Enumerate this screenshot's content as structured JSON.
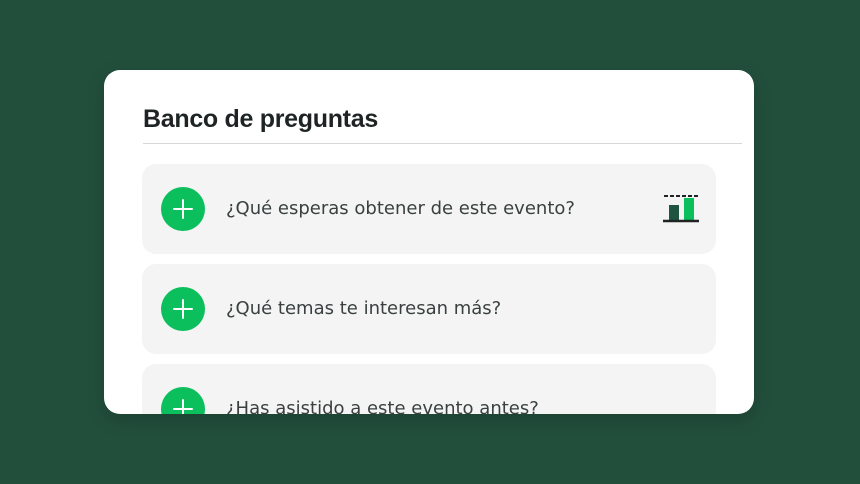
{
  "question_bank": {
    "title": "Banco de preguntas",
    "questions": [
      {
        "text": "¿Qué esperas obtener de este evento?",
        "icon": "bar-chart-icon"
      },
      {
        "text": "¿Qué temas te interesan más?"
      },
      {
        "text": "¿Has asistido a este evento antes?"
      }
    ]
  },
  "icons": {
    "add": "plus-icon",
    "type": "bar-chart-icon"
  },
  "colors": {
    "background": "#224f3c",
    "accent": "#0bbf5d",
    "dark_green": "#1f5540",
    "item_background": "#f4f4f4"
  }
}
